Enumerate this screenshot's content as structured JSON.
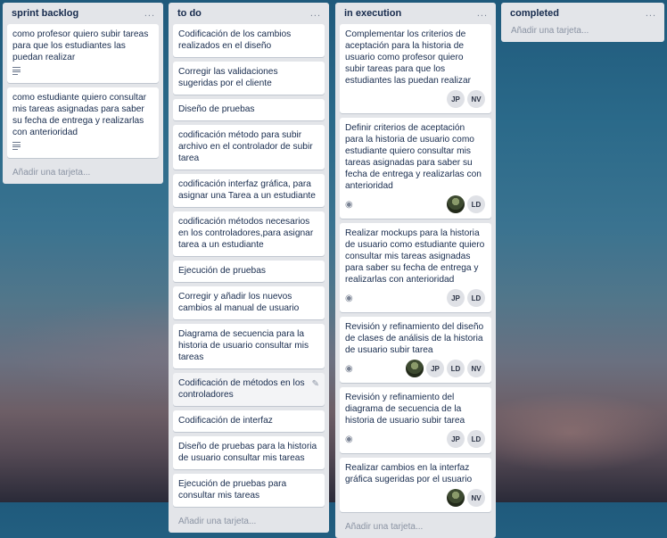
{
  "lists": [
    {
      "title": "sprint backlog",
      "menu": "...",
      "cards": [
        {
          "text": "como profesor quiero subir tareas para que los estudiantes las puedan realizar"
        },
        {
          "text": "como estudiante quiero consultar mis tareas asignadas para saber su fecha de entrega y realizarlas con anterioridad"
        }
      ],
      "add_card": "Añadir una tarjeta..."
    },
    {
      "title": "to do",
      "menu": "...",
      "cards": [
        {
          "text": "Codificación de los cambios realizados en el diseño"
        },
        {
          "text": "Corregir las validaciones sugeridas por el cliente"
        },
        {
          "text": "Diseño de pruebas"
        },
        {
          "text": "codificación método para subir archivo en el controlador de subir tarea"
        },
        {
          "text": "codificación interfaz gráfica, para asignar una Tarea a un estudiante"
        },
        {
          "text": "codificación métodos necesarios en los controladores,para asignar tarea a un estudiante"
        },
        {
          "text": "Ejecución de pruebas"
        },
        {
          "text": "Corregir y añadir los nuevos cambios al manual de usuario"
        },
        {
          "text": "Diagrama de secuencia para la historia de usuario consultar mis tareas"
        },
        {
          "text": "Codificación de métodos en los controladores"
        },
        {
          "text": "Codificación de interfaz"
        },
        {
          "text": "Diseño de pruebas para la historia de usuario consultar mis tareas"
        },
        {
          "text": "Ejecución de pruebas para consultar mis tareas"
        }
      ],
      "add_card": "Añadir una tarjeta..."
    },
    {
      "title": "in execution",
      "menu": "...",
      "cards": [
        {
          "text": "Complementar los criterios de aceptación para la historia de usuario como profesor quiero subir tareas para que los estudiantes las puedan realizar",
          "members": [
            "JP",
            "NV"
          ]
        },
        {
          "text": "Definir criterios de aceptación para la historia de usuario como estudiante quiero consultar mis tareas asignadas para saber su fecha de entrega y realizarlas con anterioridad",
          "members": [
            "LD"
          ]
        },
        {
          "text": "Realizar mockups para la historia de usuario como estudiante quiero consultar mis tareas asignadas para saber su fecha de entrega y realizarlas con anterioridad",
          "members": [
            "JP",
            "LD"
          ]
        },
        {
          "text": "Revisión y refinamiento del diseño de clases de análisis de la historia de usuario subir tarea",
          "members": [
            "JP",
            "LD",
            "NV"
          ]
        },
        {
          "text": "Revisión y refinamiento del diagrama de secuencia de la historia de usuario subir tarea",
          "members": [
            "JP",
            "LD"
          ]
        },
        {
          "text": "Realizar cambios en la interfaz gráfica sugeridas por el usuario",
          "members": [
            "NV"
          ]
        }
      ],
      "add_card": "Añadir una tarjeta..."
    },
    {
      "title": "completed",
      "menu": "...",
      "add_card": "Añadir una tarjeta..."
    }
  ],
  "colors": {
    "list_bg": "#e3e5e9",
    "card_bg": "#ffffff",
    "avatar_bg": "#dfe1e6"
  }
}
